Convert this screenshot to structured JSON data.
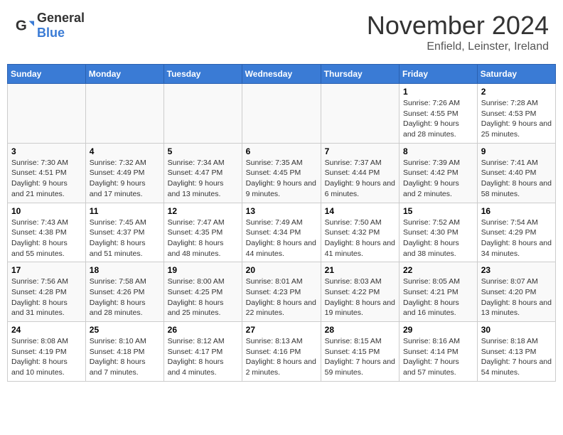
{
  "header": {
    "logo_general": "General",
    "logo_blue": "Blue",
    "month_year": "November 2024",
    "location": "Enfield, Leinster, Ireland"
  },
  "days_of_week": [
    "Sunday",
    "Monday",
    "Tuesday",
    "Wednesday",
    "Thursday",
    "Friday",
    "Saturday"
  ],
  "weeks": [
    {
      "days": [
        {
          "number": "",
          "info": ""
        },
        {
          "number": "",
          "info": ""
        },
        {
          "number": "",
          "info": ""
        },
        {
          "number": "",
          "info": ""
        },
        {
          "number": "",
          "info": ""
        },
        {
          "number": "1",
          "info": "Sunrise: 7:26 AM\nSunset: 4:55 PM\nDaylight: 9 hours and 28 minutes."
        },
        {
          "number": "2",
          "info": "Sunrise: 7:28 AM\nSunset: 4:53 PM\nDaylight: 9 hours and 25 minutes."
        }
      ]
    },
    {
      "days": [
        {
          "number": "3",
          "info": "Sunrise: 7:30 AM\nSunset: 4:51 PM\nDaylight: 9 hours and 21 minutes."
        },
        {
          "number": "4",
          "info": "Sunrise: 7:32 AM\nSunset: 4:49 PM\nDaylight: 9 hours and 17 minutes."
        },
        {
          "number": "5",
          "info": "Sunrise: 7:34 AM\nSunset: 4:47 PM\nDaylight: 9 hours and 13 minutes."
        },
        {
          "number": "6",
          "info": "Sunrise: 7:35 AM\nSunset: 4:45 PM\nDaylight: 9 hours and 9 minutes."
        },
        {
          "number": "7",
          "info": "Sunrise: 7:37 AM\nSunset: 4:44 PM\nDaylight: 9 hours and 6 minutes."
        },
        {
          "number": "8",
          "info": "Sunrise: 7:39 AM\nSunset: 4:42 PM\nDaylight: 9 hours and 2 minutes."
        },
        {
          "number": "9",
          "info": "Sunrise: 7:41 AM\nSunset: 4:40 PM\nDaylight: 8 hours and 58 minutes."
        }
      ]
    },
    {
      "days": [
        {
          "number": "10",
          "info": "Sunrise: 7:43 AM\nSunset: 4:38 PM\nDaylight: 8 hours and 55 minutes."
        },
        {
          "number": "11",
          "info": "Sunrise: 7:45 AM\nSunset: 4:37 PM\nDaylight: 8 hours and 51 minutes."
        },
        {
          "number": "12",
          "info": "Sunrise: 7:47 AM\nSunset: 4:35 PM\nDaylight: 8 hours and 48 minutes."
        },
        {
          "number": "13",
          "info": "Sunrise: 7:49 AM\nSunset: 4:34 PM\nDaylight: 8 hours and 44 minutes."
        },
        {
          "number": "14",
          "info": "Sunrise: 7:50 AM\nSunset: 4:32 PM\nDaylight: 8 hours and 41 minutes."
        },
        {
          "number": "15",
          "info": "Sunrise: 7:52 AM\nSunset: 4:30 PM\nDaylight: 8 hours and 38 minutes."
        },
        {
          "number": "16",
          "info": "Sunrise: 7:54 AM\nSunset: 4:29 PM\nDaylight: 8 hours and 34 minutes."
        }
      ]
    },
    {
      "days": [
        {
          "number": "17",
          "info": "Sunrise: 7:56 AM\nSunset: 4:28 PM\nDaylight: 8 hours and 31 minutes."
        },
        {
          "number": "18",
          "info": "Sunrise: 7:58 AM\nSunset: 4:26 PM\nDaylight: 8 hours and 28 minutes."
        },
        {
          "number": "19",
          "info": "Sunrise: 8:00 AM\nSunset: 4:25 PM\nDaylight: 8 hours and 25 minutes."
        },
        {
          "number": "20",
          "info": "Sunrise: 8:01 AM\nSunset: 4:23 PM\nDaylight: 8 hours and 22 minutes."
        },
        {
          "number": "21",
          "info": "Sunrise: 8:03 AM\nSunset: 4:22 PM\nDaylight: 8 hours and 19 minutes."
        },
        {
          "number": "22",
          "info": "Sunrise: 8:05 AM\nSunset: 4:21 PM\nDaylight: 8 hours and 16 minutes."
        },
        {
          "number": "23",
          "info": "Sunrise: 8:07 AM\nSunset: 4:20 PM\nDaylight: 8 hours and 13 minutes."
        }
      ]
    },
    {
      "days": [
        {
          "number": "24",
          "info": "Sunrise: 8:08 AM\nSunset: 4:19 PM\nDaylight: 8 hours and 10 minutes."
        },
        {
          "number": "25",
          "info": "Sunrise: 8:10 AM\nSunset: 4:18 PM\nDaylight: 8 hours and 7 minutes."
        },
        {
          "number": "26",
          "info": "Sunrise: 8:12 AM\nSunset: 4:17 PM\nDaylight: 8 hours and 4 minutes."
        },
        {
          "number": "27",
          "info": "Sunrise: 8:13 AM\nSunset: 4:16 PM\nDaylight: 8 hours and 2 minutes."
        },
        {
          "number": "28",
          "info": "Sunrise: 8:15 AM\nSunset: 4:15 PM\nDaylight: 7 hours and 59 minutes."
        },
        {
          "number": "29",
          "info": "Sunrise: 8:16 AM\nSunset: 4:14 PM\nDaylight: 7 hours and 57 minutes."
        },
        {
          "number": "30",
          "info": "Sunrise: 8:18 AM\nSunset: 4:13 PM\nDaylight: 7 hours and 54 minutes."
        }
      ]
    }
  ]
}
